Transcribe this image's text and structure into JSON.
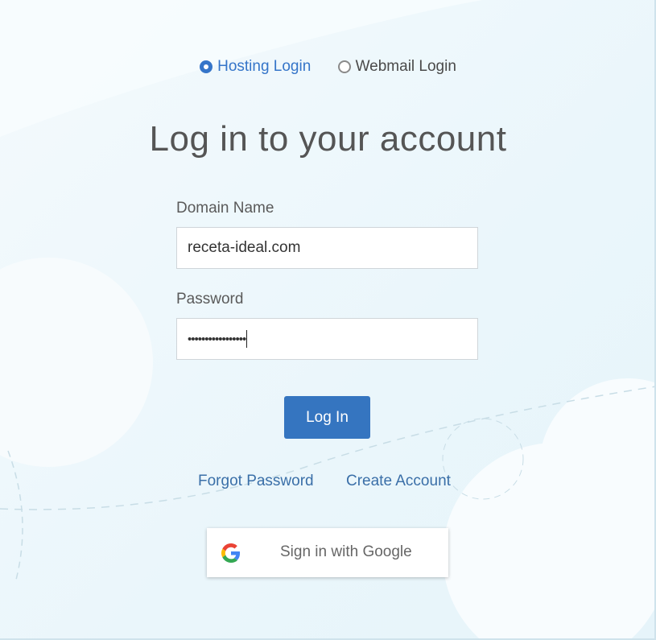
{
  "login_type": {
    "options": [
      {
        "label": "Hosting Login",
        "selected": true
      },
      {
        "label": "Webmail Login",
        "selected": false
      }
    ]
  },
  "title": "Log in to your account",
  "form": {
    "domain_label": "Domain Name",
    "domain_value": "receta-ideal.com",
    "password_label": "Password",
    "password_value": "•••••••••••••••••",
    "submit_label": "Log In"
  },
  "links": {
    "forgot": "Forgot Password",
    "create": "Create Account"
  },
  "google": {
    "label": "Sign in with Google",
    "icon": "google-g-icon"
  },
  "colors": {
    "accent": "#3575c0",
    "link": "#3a6fa8",
    "background": "#eef8fc"
  }
}
